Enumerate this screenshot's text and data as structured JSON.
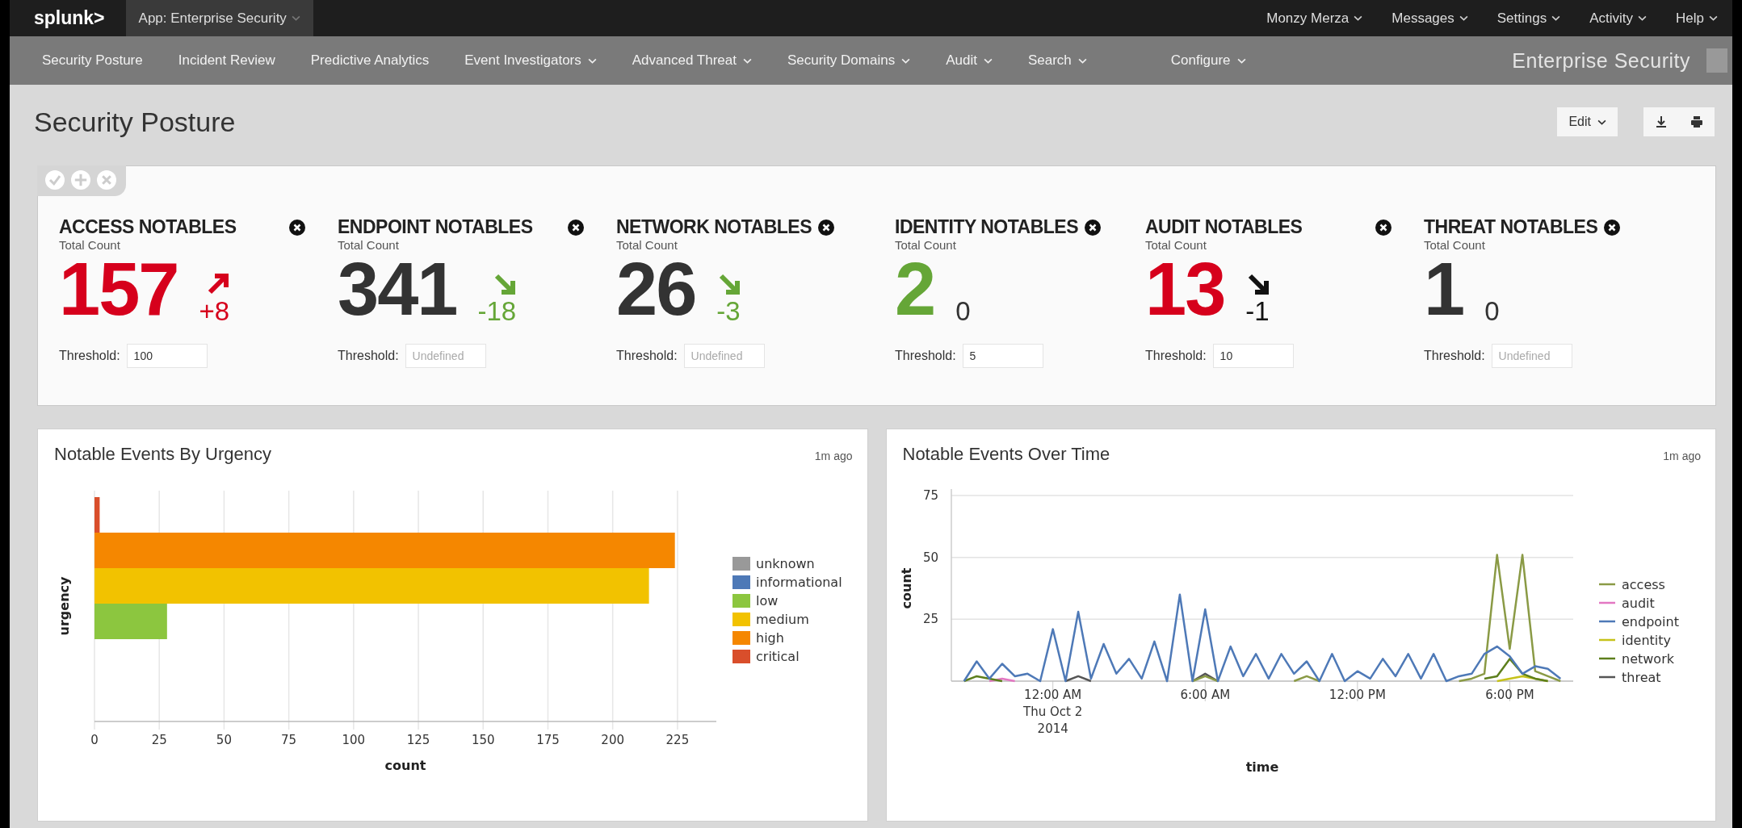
{
  "top_bar": {
    "logo": "splunk>",
    "app_menu": {
      "label": "App: Enterprise Security",
      "dropdown": true
    },
    "menus": [
      {
        "label": "Monzy Merza",
        "dropdown": true
      },
      {
        "label": "Messages",
        "dropdown": true
      },
      {
        "label": "Settings",
        "dropdown": true
      },
      {
        "label": "Activity",
        "dropdown": true
      },
      {
        "label": "Help",
        "dropdown": true
      }
    ]
  },
  "nav": {
    "items": [
      {
        "label": "Security Posture",
        "dropdown": false
      },
      {
        "label": "Incident Review",
        "dropdown": false
      },
      {
        "label": "Predictive Analytics",
        "dropdown": false
      },
      {
        "label": "Event Investigators",
        "dropdown": true
      },
      {
        "label": "Advanced Threat",
        "dropdown": true
      },
      {
        "label": "Security Domains",
        "dropdown": true
      },
      {
        "label": "Audit",
        "dropdown": true
      },
      {
        "label": "Search",
        "dropdown": true
      },
      {
        "label": "Configure",
        "dropdown": true
      }
    ],
    "app_title": "Enterprise Security"
  },
  "page": {
    "title": "Security Posture",
    "edit_button": "Edit"
  },
  "notables": [
    {
      "title": "ACCESS NOTABLES",
      "subtitle": "Total Count",
      "count": "157",
      "color": "#d6001c",
      "kind": "rising",
      "delta": {
        "text": "+8",
        "color": "#d6001c"
      },
      "threshold_label": "Threshold:",
      "threshold": {
        "value": "100"
      }
    },
    {
      "title": "ENDPOINT NOTABLES",
      "subtitle": "Total Count",
      "count": "341",
      "color": "#333333",
      "kind": "falling",
      "delta": {
        "text": "-18",
        "color": "#65a637"
      },
      "threshold_label": "Threshold:",
      "threshold": {
        "placeholder": "Undefined"
      }
    },
    {
      "title": "NETWORK NOTABLES",
      "subtitle": "Total Count",
      "count": "26",
      "color": "#333333",
      "kind": "falling",
      "delta": {
        "text": "-3",
        "color": "#65a637"
      },
      "threshold_label": "Threshold:",
      "threshold": {
        "placeholder": "Undefined"
      }
    },
    {
      "title": "IDENTITY NOTABLES",
      "subtitle": "Total Count",
      "count": "2",
      "color": "#65a637",
      "kind": "steady",
      "delta": {
        "text": "0",
        "color": "#333333"
      },
      "threshold_label": "Threshold:",
      "threshold": {
        "value": "5"
      }
    },
    {
      "title": "AUDIT NOTABLES",
      "subtitle": "Total Count",
      "count": "13",
      "color": "#d6001c",
      "kind": "falling",
      "delta": {
        "text": "-1",
        "color": "#111111"
      },
      "threshold_label": "Threshold:",
      "threshold": {
        "value": "10"
      }
    },
    {
      "title": "THREAT NOTABLES",
      "subtitle": "Total Count",
      "count": "1",
      "color": "#333333",
      "kind": "steady",
      "delta": {
        "text": "0",
        "color": "#333333"
      },
      "threshold_label": "Threshold:",
      "threshold": {
        "placeholder": "Undefined"
      }
    }
  ],
  "panels": [
    {
      "title": "Notable Events By Urgency",
      "updated": "1m ago",
      "chart_data": {
        "type": "bar",
        "orientation": "horizontal",
        "xlabel": "count",
        "ylabel": "urgency",
        "legend": "right",
        "grid": true,
        "xlim": [
          0,
          240
        ],
        "xticks": [
          0,
          25,
          50,
          75,
          100,
          125,
          150,
          175,
          200,
          225
        ],
        "series": [
          {
            "name": "unknown",
            "color": "#999999",
            "values": [
              0
            ]
          },
          {
            "name": "informational",
            "color": "#4e79b7",
            "values": [
              0
            ]
          },
          {
            "name": "low",
            "color": "#8cc63f",
            "values": [
              28
            ]
          },
          {
            "name": "medium",
            "color": "#f2c200",
            "values": [
              214
            ]
          },
          {
            "name": "high",
            "color": "#f58700",
            "values": [
              224
            ]
          },
          {
            "name": "critical",
            "color": "#d94e2b",
            "values": [
              2
            ]
          }
        ]
      }
    },
    {
      "title": "Notable Events Over Time",
      "updated": "1m ago",
      "chart_data": {
        "type": "line",
        "xlabel": "time",
        "ylabel": "count",
        "legend": "right",
        "grid": true,
        "xlim": [
          -4,
          20.5
        ],
        "ylim": [
          0,
          75
        ],
        "yticks": [
          25,
          50,
          75
        ],
        "xticks": [
          {
            "value": 0,
            "label": "12:00 AM\nThu Oct 2\n2014"
          },
          {
            "value": 6,
            "label": "6:00 AM"
          },
          {
            "value": 12,
            "label": "12:00 PM"
          },
          {
            "value": 18,
            "label": "6:00 PM"
          }
        ],
        "x": [
          -3.5,
          -3,
          -2.5,
          -2,
          -1.5,
          -1,
          -0.5,
          0,
          0.5,
          1,
          1.5,
          2,
          2.5,
          3,
          3.5,
          4,
          4.5,
          5,
          5.5,
          6,
          6.5,
          7,
          7.5,
          8,
          8.5,
          9,
          9.5,
          10,
          10.5,
          11,
          11.5,
          12,
          12.5,
          13,
          13.5,
          14,
          14.5,
          15,
          15.5,
          16,
          16.5,
          17,
          17.5,
          18,
          18.5,
          19,
          19.5,
          20
        ],
        "series": [
          {
            "name": "access",
            "color": "#8a9a45",
            "values": [
              null,
              null,
              null,
              null,
              null,
              null,
              null,
              null,
              null,
              null,
              null,
              null,
              null,
              null,
              null,
              null,
              null,
              null,
              0,
              2,
              0,
              null,
              null,
              null,
              null,
              null,
              0,
              2,
              0,
              null,
              null,
              null,
              null,
              null,
              null,
              null,
              null,
              null,
              null,
              0,
              1,
              3,
              51,
              13,
              51,
              4,
              2,
              0
            ]
          },
          {
            "name": "audit",
            "color": "#e377c2",
            "values": [
              null,
              null,
              0,
              1,
              0,
              null,
              null,
              null,
              null,
              null,
              null,
              null,
              null,
              null,
              null,
              null,
              null,
              null,
              null,
              null,
              null,
              null,
              null,
              null,
              null,
              null,
              null,
              null,
              null,
              null,
              null,
              null,
              null,
              null,
              null,
              null,
              null,
              null,
              null,
              null,
              null,
              null,
              null,
              null,
              null,
              null,
              null,
              null
            ]
          },
          {
            "name": "endpoint",
            "color": "#4e79b7",
            "values": [
              0,
              8,
              1,
              7,
              2,
              3,
              0,
              21,
              0,
              28,
              1,
              15,
              3,
              9,
              1,
              16,
              0,
              35,
              0,
              29,
              0,
              14,
              2,
              11,
              1,
              11,
              3,
              8,
              0,
              11,
              0,
              4,
              1,
              9,
              2,
              11,
              1,
              11,
              0,
              2,
              3,
              11,
              14,
              10,
              3,
              6,
              5,
              1
            ]
          },
          {
            "name": "identity",
            "color": "#c6c21a",
            "values": [
              null,
              null,
              null,
              null,
              null,
              null,
              null,
              null,
              null,
              null,
              null,
              null,
              null,
              null,
              null,
              null,
              null,
              null,
              null,
              null,
              null,
              null,
              null,
              null,
              null,
              null,
              null,
              null,
              null,
              null,
              null,
              null,
              null,
              null,
              null,
              null,
              null,
              null,
              null,
              null,
              null,
              null,
              0,
              1,
              2,
              1,
              0,
              null
            ]
          },
          {
            "name": "network",
            "color": "#5d7f1c",
            "values": [
              0,
              2,
              1,
              0,
              null,
              null,
              null,
              null,
              null,
              null,
              null,
              null,
              null,
              null,
              null,
              null,
              null,
              null,
              null,
              null,
              null,
              null,
              null,
              null,
              null,
              null,
              null,
              null,
              null,
              null,
              null,
              null,
              null,
              null,
              null,
              null,
              null,
              null,
              null,
              null,
              null,
              1,
              2,
              9,
              3,
              1,
              0,
              null
            ]
          },
          {
            "name": "threat",
            "color": "#555555",
            "values": [
              null,
              null,
              null,
              null,
              null,
              null,
              null,
              null,
              0,
              2,
              0,
              null,
              null,
              null,
              null,
              null,
              null,
              null,
              0,
              3,
              0,
              null,
              null,
              null,
              null,
              null,
              null,
              null,
              null,
              null,
              null,
              null,
              null,
              null,
              null,
              null,
              null,
              null,
              null,
              null,
              null,
              null,
              null,
              null,
              null,
              null,
              null,
              null
            ]
          }
        ]
      }
    }
  ]
}
